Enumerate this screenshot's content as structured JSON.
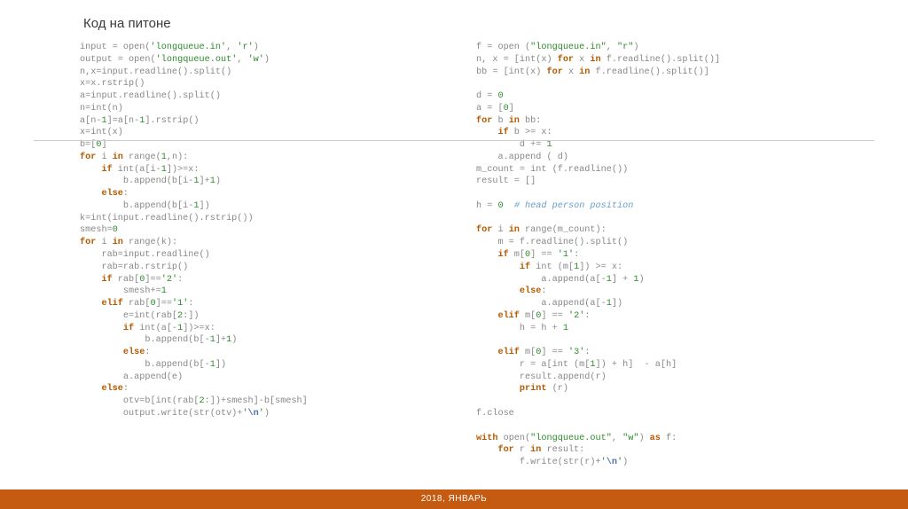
{
  "title": "Код на питоне",
  "footer": "2018, ЯНВАРЬ",
  "code_left": [
    {
      "t": "input ",
      "c": "fn"
    },
    {
      "t": "= ",
      "c": "op"
    },
    {
      "t": "open",
      "c": "fn"
    },
    {
      "t": "(",
      "c": "op"
    },
    {
      "t": "'longqueue.in'",
      "c": "str"
    },
    {
      "t": ", ",
      "c": "op"
    },
    {
      "t": "'r'",
      "c": "str"
    },
    {
      "t": ")",
      "c": "op"
    },
    {
      "t": "\n"
    },
    {
      "t": "output ",
      "c": "fn"
    },
    {
      "t": "= ",
      "c": "op"
    },
    {
      "t": "open",
      "c": "fn"
    },
    {
      "t": "(",
      "c": "op"
    },
    {
      "t": "'longqueue.out'",
      "c": "str"
    },
    {
      "t": ", ",
      "c": "op"
    },
    {
      "t": "'w'",
      "c": "str"
    },
    {
      "t": ")",
      "c": "op"
    },
    {
      "t": "\n"
    },
    {
      "t": "n,x=input.readline().split()\n",
      "c": "fn"
    },
    {
      "t": "x=x.rstrip()\n",
      "c": "fn"
    },
    {
      "t": "a=input.readline().split()\n",
      "c": "fn"
    },
    {
      "t": "n=int(n)\n",
      "c": "fn"
    },
    {
      "t": "a[n-",
      "c": "fn"
    },
    {
      "t": "1",
      "c": "lit"
    },
    {
      "t": "]=a[n-",
      "c": "fn"
    },
    {
      "t": "1",
      "c": "lit"
    },
    {
      "t": "].rstrip()\n",
      "c": "fn"
    },
    {
      "t": "x=int(x)\n",
      "c": "fn"
    },
    {
      "t": "b=[",
      "c": "fn"
    },
    {
      "t": "0",
      "c": "lit"
    },
    {
      "t": "]\n",
      "c": "fn"
    },
    {
      "t": "for",
      "c": "kw"
    },
    {
      "t": " i ",
      "c": "fn"
    },
    {
      "t": "in",
      "c": "kw"
    },
    {
      "t": " range(",
      "c": "fn"
    },
    {
      "t": "1",
      "c": "lit"
    },
    {
      "t": ",n):\n",
      "c": "fn"
    },
    {
      "t": "    if",
      "c": "kw"
    },
    {
      "t": " int(a[i-",
      "c": "fn"
    },
    {
      "t": "1",
      "c": "lit"
    },
    {
      "t": "])>=x:\n",
      "c": "fn"
    },
    {
      "t": "        b.append(b[i-",
      "c": "fn"
    },
    {
      "t": "1",
      "c": "lit"
    },
    {
      "t": "]+",
      "c": "fn"
    },
    {
      "t": "1",
      "c": "lit"
    },
    {
      "t": ")\n",
      "c": "fn"
    },
    {
      "t": "    else",
      "c": "kw"
    },
    {
      "t": ":\n",
      "c": "fn"
    },
    {
      "t": "        b.append(b[i-",
      "c": "fn"
    },
    {
      "t": "1",
      "c": "lit"
    },
    {
      "t": "])\n",
      "c": "fn"
    },
    {
      "t": "k=int(input.readline().rstrip())\n",
      "c": "fn"
    },
    {
      "t": "smesh=",
      "c": "fn"
    },
    {
      "t": "0",
      "c": "lit"
    },
    {
      "t": "\n"
    },
    {
      "t": "for",
      "c": "kw"
    },
    {
      "t": " i ",
      "c": "fn"
    },
    {
      "t": "in",
      "c": "kw"
    },
    {
      "t": " range(k):\n",
      "c": "fn"
    },
    {
      "t": "    rab=input.readline()\n",
      "c": "fn"
    },
    {
      "t": "    rab=rab.rstrip()\n",
      "c": "fn"
    },
    {
      "t": "    if",
      "c": "kw"
    },
    {
      "t": " rab[",
      "c": "fn"
    },
    {
      "t": "0",
      "c": "lit"
    },
    {
      "t": "]==",
      "c": "fn"
    },
    {
      "t": "'2'",
      "c": "str"
    },
    {
      "t": ":\n",
      "c": "fn"
    },
    {
      "t": "        smesh+=",
      "c": "fn"
    },
    {
      "t": "1",
      "c": "lit"
    },
    {
      "t": "\n"
    },
    {
      "t": "    elif",
      "c": "kw"
    },
    {
      "t": " rab[",
      "c": "fn"
    },
    {
      "t": "0",
      "c": "lit"
    },
    {
      "t": "]==",
      "c": "fn"
    },
    {
      "t": "'1'",
      "c": "str"
    },
    {
      "t": ":\n",
      "c": "fn"
    },
    {
      "t": "        e=int(rab[",
      "c": "fn"
    },
    {
      "t": "2",
      "c": "lit"
    },
    {
      "t": ":])\n",
      "c": "fn"
    },
    {
      "t": "        if",
      "c": "kw"
    },
    {
      "t": " int(a[-",
      "c": "fn"
    },
    {
      "t": "1",
      "c": "lit"
    },
    {
      "t": "])>=x:\n",
      "c": "fn"
    },
    {
      "t": "            b.append(b[-",
      "c": "fn"
    },
    {
      "t": "1",
      "c": "lit"
    },
    {
      "t": "]+",
      "c": "fn"
    },
    {
      "t": "1",
      "c": "lit"
    },
    {
      "t": ")\n",
      "c": "fn"
    },
    {
      "t": "        else",
      "c": "kw"
    },
    {
      "t": ":\n",
      "c": "fn"
    },
    {
      "t": "            b.append(b[-",
      "c": "fn"
    },
    {
      "t": "1",
      "c": "lit"
    },
    {
      "t": "])\n",
      "c": "fn"
    },
    {
      "t": "        a.append(e)\n",
      "c": "fn"
    },
    {
      "t": "    else",
      "c": "kw"
    },
    {
      "t": ":\n",
      "c": "fn"
    },
    {
      "t": "        otv=b[int(rab[",
      "c": "fn"
    },
    {
      "t": "2",
      "c": "lit"
    },
    {
      "t": ":])+smesh]-b[smesh]\n",
      "c": "fn"
    },
    {
      "t": "        output.write(str(otv)+",
      "c": "fn"
    },
    {
      "t": "'",
      "c": "str"
    },
    {
      "t": "\\n",
      "c": "esc"
    },
    {
      "t": "'",
      "c": "str"
    },
    {
      "t": ")\n",
      "c": "fn"
    }
  ],
  "code_right": [
    {
      "t": "f = open (",
      "c": "fn"
    },
    {
      "t": "\"longqueue.in\"",
      "c": "str"
    },
    {
      "t": ", ",
      "c": "fn"
    },
    {
      "t": "\"r\"",
      "c": "str"
    },
    {
      "t": ")\n",
      "c": "fn"
    },
    {
      "t": "n, x = [int(x) ",
      "c": "fn"
    },
    {
      "t": "for",
      "c": "kw"
    },
    {
      "t": " x ",
      "c": "fn"
    },
    {
      "t": "in",
      "c": "kw"
    },
    {
      "t": " f.readline().split()]\n",
      "c": "fn"
    },
    {
      "t": "bb = [int(x) ",
      "c": "fn"
    },
    {
      "t": "for",
      "c": "kw"
    },
    {
      "t": " x ",
      "c": "fn"
    },
    {
      "t": "in",
      "c": "kw"
    },
    {
      "t": " f.readline().split()]\n",
      "c": "fn"
    },
    {
      "t": "\n"
    },
    {
      "t": "d = ",
      "c": "fn"
    },
    {
      "t": "0",
      "c": "lit"
    },
    {
      "t": "\n"
    },
    {
      "t": "a = [",
      "c": "fn"
    },
    {
      "t": "0",
      "c": "lit"
    },
    {
      "t": "]\n",
      "c": "fn"
    },
    {
      "t": "for",
      "c": "kw"
    },
    {
      "t": " b ",
      "c": "fn"
    },
    {
      "t": "in",
      "c": "kw"
    },
    {
      "t": " bb:\n",
      "c": "fn"
    },
    {
      "t": "    if",
      "c": "kw"
    },
    {
      "t": " b >= x:\n",
      "c": "fn"
    },
    {
      "t": "        d += ",
      "c": "fn"
    },
    {
      "t": "1",
      "c": "lit"
    },
    {
      "t": "\n"
    },
    {
      "t": "    a.append ( d)\n",
      "c": "fn"
    },
    {
      "t": "m_count = int (f.readline())\n",
      "c": "fn"
    },
    {
      "t": "result = []\n",
      "c": "fn"
    },
    {
      "t": "\n"
    },
    {
      "t": "h = ",
      "c": "fn"
    },
    {
      "t": "0",
      "c": "lit"
    },
    {
      "t": "  ",
      "c": "fn"
    },
    {
      "t": "# head person position",
      "c": "cm"
    },
    {
      "t": "\n"
    },
    {
      "t": "\n"
    },
    {
      "t": "for",
      "c": "kw"
    },
    {
      "t": " i ",
      "c": "fn"
    },
    {
      "t": "in",
      "c": "kw"
    },
    {
      "t": " range(m_count):\n",
      "c": "fn"
    },
    {
      "t": "    m = f.readline().split()\n",
      "c": "fn"
    },
    {
      "t": "    if",
      "c": "kw"
    },
    {
      "t": " m[",
      "c": "fn"
    },
    {
      "t": "0",
      "c": "lit"
    },
    {
      "t": "] == ",
      "c": "fn"
    },
    {
      "t": "'1'",
      "c": "str"
    },
    {
      "t": ":\n",
      "c": "fn"
    },
    {
      "t": "        if",
      "c": "kw"
    },
    {
      "t": " int (m[",
      "c": "fn"
    },
    {
      "t": "1",
      "c": "lit"
    },
    {
      "t": "]) >= x:\n",
      "c": "fn"
    },
    {
      "t": "            a.append(a[-",
      "c": "fn"
    },
    {
      "t": "1",
      "c": "lit"
    },
    {
      "t": "] + ",
      "c": "fn"
    },
    {
      "t": "1",
      "c": "lit"
    },
    {
      "t": ")\n",
      "c": "fn"
    },
    {
      "t": "        else",
      "c": "kw"
    },
    {
      "t": ":\n",
      "c": "fn"
    },
    {
      "t": "            a.append(a[-",
      "c": "fn"
    },
    {
      "t": "1",
      "c": "lit"
    },
    {
      "t": "])\n",
      "c": "fn"
    },
    {
      "t": "    elif",
      "c": "kw"
    },
    {
      "t": " m[",
      "c": "fn"
    },
    {
      "t": "0",
      "c": "lit"
    },
    {
      "t": "] == ",
      "c": "fn"
    },
    {
      "t": "'2'",
      "c": "str"
    },
    {
      "t": ":\n",
      "c": "fn"
    },
    {
      "t": "        h = h + ",
      "c": "fn"
    },
    {
      "t": "1",
      "c": "lit"
    },
    {
      "t": "\n"
    },
    {
      "t": "\n"
    },
    {
      "t": "    elif",
      "c": "kw"
    },
    {
      "t": " m[",
      "c": "fn"
    },
    {
      "t": "0",
      "c": "lit"
    },
    {
      "t": "] == ",
      "c": "fn"
    },
    {
      "t": "'3'",
      "c": "str"
    },
    {
      "t": ":\n",
      "c": "fn"
    },
    {
      "t": "        r = a[int (m[",
      "c": "fn"
    },
    {
      "t": "1",
      "c": "lit"
    },
    {
      "t": "]) + h]  - a[h]\n",
      "c": "fn"
    },
    {
      "t": "        result.append(r)\n",
      "c": "fn"
    },
    {
      "t": "        ",
      "c": "fn"
    },
    {
      "t": "print",
      "c": "kw"
    },
    {
      "t": " (r)\n",
      "c": "fn"
    },
    {
      "t": "\n"
    },
    {
      "t": "f.close\n",
      "c": "fn"
    },
    {
      "t": "\n"
    },
    {
      "t": "with",
      "c": "kw"
    },
    {
      "t": " open(",
      "c": "fn"
    },
    {
      "t": "\"longqueue.out\"",
      "c": "str"
    },
    {
      "t": ", ",
      "c": "fn"
    },
    {
      "t": "\"w\"",
      "c": "str"
    },
    {
      "t": ") ",
      "c": "fn"
    },
    {
      "t": "as",
      "c": "kw"
    },
    {
      "t": " f:\n",
      "c": "fn"
    },
    {
      "t": "    for",
      "c": "kw"
    },
    {
      "t": " r ",
      "c": "fn"
    },
    {
      "t": "in",
      "c": "kw"
    },
    {
      "t": " result:\n",
      "c": "fn"
    },
    {
      "t": "        f.write(str(r)+",
      "c": "fn"
    },
    {
      "t": "'",
      "c": "str"
    },
    {
      "t": "\\n",
      "c": "esc"
    },
    {
      "t": "'",
      "c": "str"
    },
    {
      "t": ")\n",
      "c": "fn"
    }
  ]
}
